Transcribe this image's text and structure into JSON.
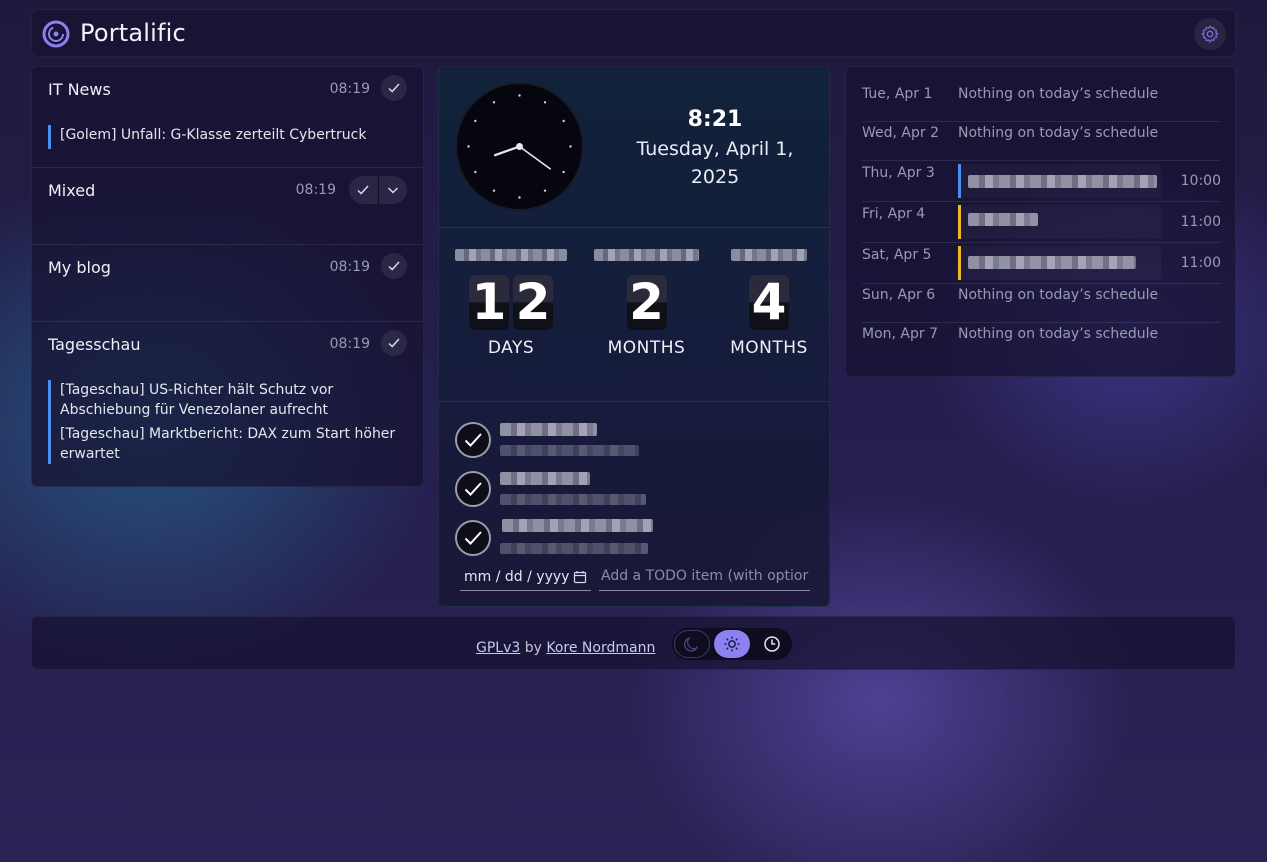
{
  "app": {
    "title": "Portalific"
  },
  "feeds": [
    {
      "title": "IT News",
      "time": "08:19",
      "items": [
        "[Golem] Unfall: G-Klasse zerteilt Cybertruck"
      ]
    },
    {
      "title": "Mixed",
      "time": "08:19",
      "items": []
    },
    {
      "title": "My blog",
      "time": "08:19",
      "items": []
    },
    {
      "title": "Tagesschau",
      "time": "08:19",
      "items": [
        "[Tageschau] US-Richter hält Schutz vor Abschiebung für Venezolaner aufrecht",
        "[Tageschau] Marktbericht: DAX zum Start höher erwartet"
      ]
    }
  ],
  "clock": {
    "time": "8:21",
    "date": "Tuesday, April 1, 2025",
    "hour": 8,
    "minute": 21
  },
  "countdowns": [
    {
      "digits": [
        "1",
        "2"
      ],
      "unit": "DAYS"
    },
    {
      "digits": [
        "2"
      ],
      "unit": "MONTHS"
    },
    {
      "digits": [
        "4"
      ],
      "unit": "MONTHS"
    }
  ],
  "todo": {
    "count_completed": 3,
    "date_placeholder": "mm / dd / yyyy",
    "input_placeholder": "Add a TODO item (with optior"
  },
  "calendar": [
    {
      "day": "Tue, Apr 1",
      "empty_text": "Nothing on today’s schedule"
    },
    {
      "day": "Wed, Apr 2",
      "empty_text": "Nothing on today’s schedule"
    },
    {
      "day": "Thu, Apr 3",
      "event_time": "10:00",
      "event_color": "#4a8ef0"
    },
    {
      "day": "Fri, Apr 4",
      "event_time": "11:00",
      "event_color": "#f0b820"
    },
    {
      "day": "Sat, Apr 5",
      "event_time": "11:00",
      "event_color": "#f0b820"
    },
    {
      "day": "Sun, Apr 6",
      "empty_text": "Nothing on today’s schedule"
    },
    {
      "day": "Mon, Apr 7",
      "empty_text": "Nothing on today’s schedule"
    }
  ],
  "footer": {
    "license": "GPLv3",
    "by": "by",
    "author": "Kore Nordmann"
  },
  "theme": {
    "options": [
      "moon-icon",
      "sun-icon",
      "clock-icon"
    ],
    "active": "sun-icon",
    "accent": "#8b82f0"
  }
}
